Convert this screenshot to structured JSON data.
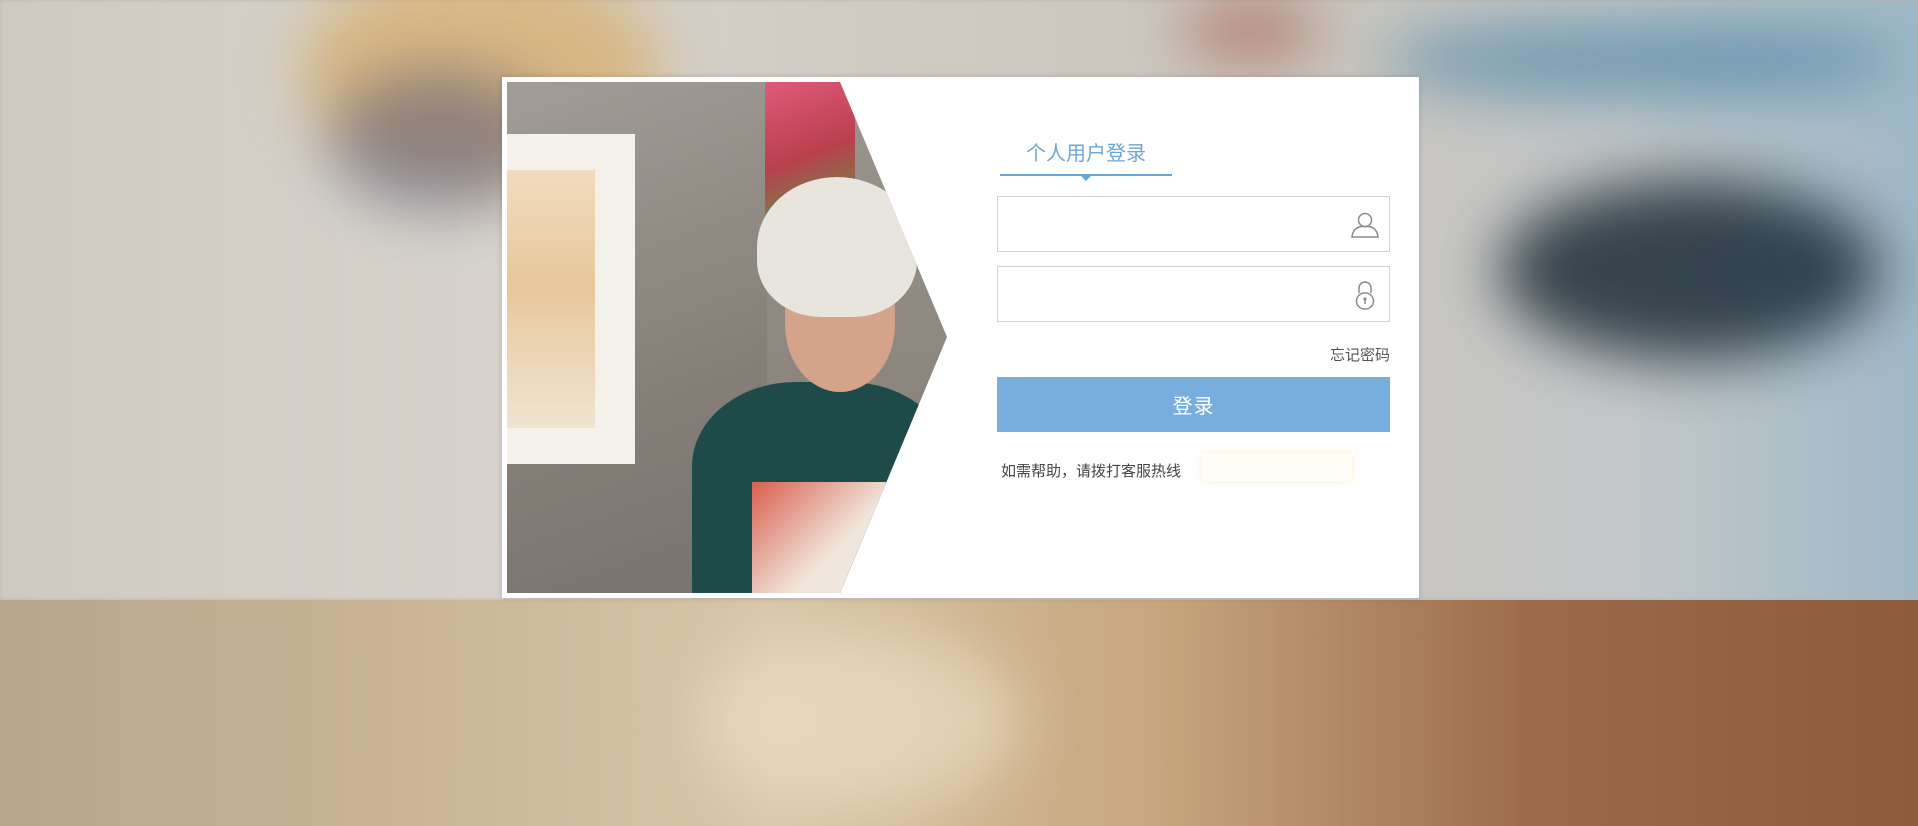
{
  "login": {
    "tab_label": "个人用户登录",
    "username": {
      "value": "",
      "placeholder": "",
      "icon": "user-icon"
    },
    "password": {
      "value": "",
      "placeholder": "",
      "icon": "lock-icon"
    },
    "forgot_password": "忘记密码",
    "submit_label": "登录",
    "help_text": "如需帮助，请拨打客服热线",
    "hotline": ""
  },
  "colors": {
    "accent": "#6fa6d8",
    "button": "#78aedd",
    "card_background": "#ffffff"
  }
}
